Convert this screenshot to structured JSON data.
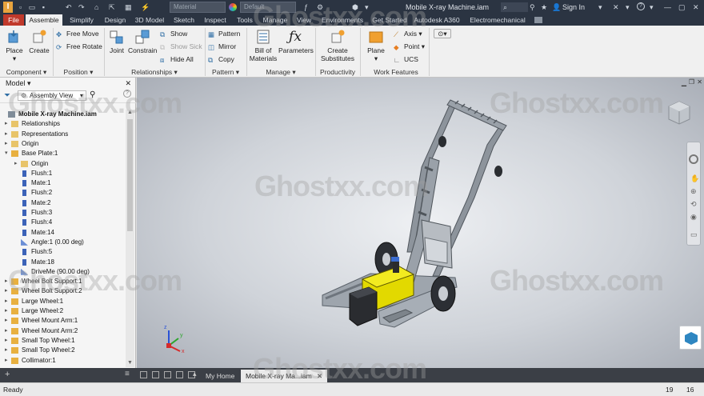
{
  "titlebar": {
    "app_icon": "inventor-logo",
    "style_placeholder": "Material",
    "appearance_placeholder": "Default",
    "doc_title": "Mobile X-ray Machine.iam",
    "sign_in": "Sign In",
    "help": "?",
    "icons": [
      "save-icon",
      "undo-icon",
      "redo-icon",
      "home-icon",
      "folder-icon",
      "search-icon",
      "star-icon",
      "user-icon",
      "minimize-icon",
      "maximize-icon",
      "close-icon"
    ]
  },
  "tabs": [
    "File",
    "Assemble",
    "Simplify",
    "Design",
    "3D Model",
    "Sketch",
    "Inspect",
    "Tools",
    "Manage",
    "View",
    "Environments",
    "Get Started",
    "Autodesk A360",
    "Electromechanical"
  ],
  "active_tab": "Assemble",
  "ribbon": {
    "component": {
      "place": "Place",
      "create": "Create",
      "label": "Component"
    },
    "position": {
      "free_move": "Free Move",
      "free_rotate": "Free Rotate",
      "label": "Position"
    },
    "relationships": {
      "joint": "Joint",
      "constrain": "Constrain",
      "show": "Show",
      "show_sick": "Show Sick",
      "hide_all": "Hide All",
      "label": "Relationships"
    },
    "pattern": {
      "pattern": "Pattern",
      "mirror": "Mirror",
      "copy": "Copy",
      "label": "Pattern"
    },
    "manage": {
      "bom": "Bill of Materials",
      "parameters": "Parameters",
      "label": "Manage"
    },
    "productivity": {
      "create_substitutes": "Create Substitutes",
      "label": "Productivity"
    },
    "work_features": {
      "plane": "Plane",
      "axis": "Axis",
      "point": "Point",
      "ucs": "UCS",
      "label": "Work Features"
    }
  },
  "browser": {
    "title": "Model",
    "view_select": "Assembly View",
    "tree": [
      {
        "label": "Mobile X-ray Machine.iam",
        "level": 0,
        "icon": "assembly",
        "expand": "",
        "bold": true
      },
      {
        "label": "Relationships",
        "level": 1,
        "icon": "folder",
        "expand": "+"
      },
      {
        "label": "Representations",
        "level": 1,
        "icon": "folder",
        "expand": "+"
      },
      {
        "label": "Origin",
        "level": 1,
        "icon": "folder",
        "expand": "+"
      },
      {
        "label": "Base Plate:1",
        "level": 1,
        "icon": "part",
        "expand": "-"
      },
      {
        "label": "Origin",
        "level": 2,
        "icon": "folder",
        "expand": "+"
      },
      {
        "label": "Flush:1",
        "level": 2,
        "icon": "constraint",
        "expand": ""
      },
      {
        "label": "Mate:1",
        "level": 2,
        "icon": "constraint",
        "expand": ""
      },
      {
        "label": "Flush:2",
        "level": 2,
        "icon": "constraint",
        "expand": ""
      },
      {
        "label": "Mate:2",
        "level": 2,
        "icon": "constraint",
        "expand": ""
      },
      {
        "label": "Flush:3",
        "level": 2,
        "icon": "constraint",
        "expand": ""
      },
      {
        "label": "Flush:4",
        "level": 2,
        "icon": "constraint",
        "expand": ""
      },
      {
        "label": "Mate:14",
        "level": 2,
        "icon": "constraint",
        "expand": ""
      },
      {
        "label": "Angle:1 (0.00 deg)",
        "level": 2,
        "icon": "angle",
        "expand": ""
      },
      {
        "label": "Flush:5",
        "level": 2,
        "icon": "constraint",
        "expand": ""
      },
      {
        "label": "Mate:18",
        "level": 2,
        "icon": "constraint",
        "expand": ""
      },
      {
        "label": "DriveMe (90.00 deg)",
        "level": 2,
        "icon": "angle",
        "expand": ""
      },
      {
        "label": "Wheel Bolt Support:1",
        "level": 1,
        "icon": "part",
        "expand": "+"
      },
      {
        "label": "Wheel Bolt Support:2",
        "level": 1,
        "icon": "part",
        "expand": "+"
      },
      {
        "label": "Large Wheel:1",
        "level": 1,
        "icon": "part",
        "expand": "+"
      },
      {
        "label": "Large Wheel:2",
        "level": 1,
        "icon": "part",
        "expand": "+"
      },
      {
        "label": "Wheel Mount Arm:1",
        "level": 1,
        "icon": "part",
        "expand": "+"
      },
      {
        "label": "Wheel Mount Arm:2",
        "level": 1,
        "icon": "part",
        "expand": "+"
      },
      {
        "label": "Small Top Wheel:1",
        "level": 1,
        "icon": "part",
        "expand": "+"
      },
      {
        "label": "Small Top Wheel:2",
        "level": 1,
        "icon": "part",
        "expand": "+"
      },
      {
        "label": "Collimator:1",
        "level": 1,
        "icon": "part",
        "expand": "+"
      }
    ]
  },
  "doc_tabs": {
    "home": "My Home",
    "active": "Mobile X-ray Ma...iam"
  },
  "status": {
    "left": "Ready",
    "n1": "19",
    "n2": "16"
  },
  "watermark": "Ghostxx.com",
  "colors": {
    "file_tab": "#c0392b",
    "titlebar": "#2b3442",
    "battery": "#e8e000",
    "viewcube_badge": "#2e86c1"
  }
}
